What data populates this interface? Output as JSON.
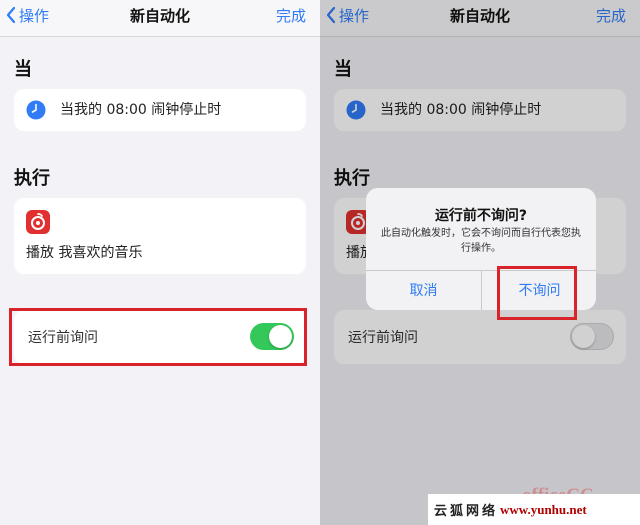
{
  "colors": {
    "accent": "#2f7cf6",
    "toggle_on": "#34c759",
    "highlight_box": "#d9232b",
    "music_app": "#e0302f"
  },
  "left": {
    "nav": {
      "back_label": "操作",
      "title": "新自动化",
      "done_label": "完成"
    },
    "when_label": "当",
    "trigger_text": "当我的 08:00 闹钟停止时",
    "do_label": "执行",
    "action_text": "播放 我喜欢的音乐",
    "ask_label": "运行前询问",
    "ask_toggle_on": true
  },
  "right": {
    "nav": {
      "back_label": "操作",
      "title": "新自动化",
      "done_label": "完成"
    },
    "when_label": "当",
    "trigger_text": "当我的 08:00 闹钟停止时",
    "do_label": "执行",
    "action_text_partial": "播放",
    "ask_label": "运行前询问",
    "ask_toggle_on": false,
    "dialog": {
      "title": "运行前不询问?",
      "message": "此自动化触发时，它会不询问而自行代表您执行操作。",
      "cancel_label": "取消",
      "confirm_label": "不询问"
    }
  },
  "watermark": {
    "site_cn": "云狐网络",
    "url": "www.yunhu.net",
    "overlay": "officeCC"
  }
}
